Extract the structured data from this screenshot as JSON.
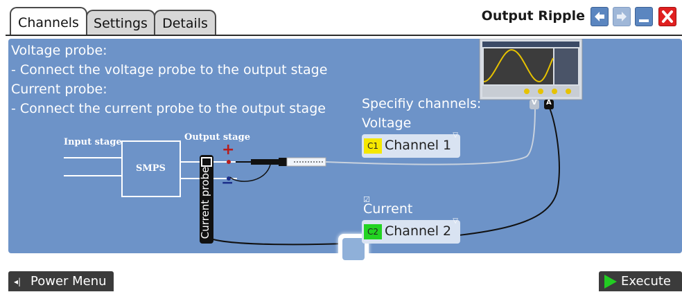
{
  "tabs": [
    {
      "label": "Channels",
      "active": true
    },
    {
      "label": "Settings",
      "active": false
    },
    {
      "label": "Details",
      "active": false
    }
  ],
  "header": {
    "title": "Output Ripple",
    "buttons": [
      "back-icon",
      "forward-icon",
      "minimize-icon",
      "close-icon"
    ]
  },
  "instructions": {
    "voltage_heading": "Voltage probe:",
    "voltage_step": "- Connect the voltage probe to the output stage",
    "current_heading": "Current probe:",
    "current_step": " - Connect the current probe to the output stage"
  },
  "diagram": {
    "input_stage": "Input stage",
    "output_stage": "Output stage",
    "smps": "SMPS",
    "plus": "+",
    "minus": "−",
    "current_probe": "Current probe",
    "port_v": "V",
    "port_a": "A"
  },
  "channels": {
    "heading": "Specifiy channels:",
    "voltage_label": "Voltage",
    "voltage_badge": "C1",
    "voltage_value": "Channel 1",
    "current_label": "Current",
    "current_badge": "C2",
    "current_value": "Channel 2",
    "current_checked": false
  },
  "footer": {
    "power_menu": "Power Menu",
    "execute": "Execute"
  },
  "colors": {
    "panel": "#6d93c8",
    "c1_badge": "#f5e800",
    "c2_badge": "#22d322",
    "execute_icon": "#22cc22",
    "close_button": "#e02020"
  }
}
